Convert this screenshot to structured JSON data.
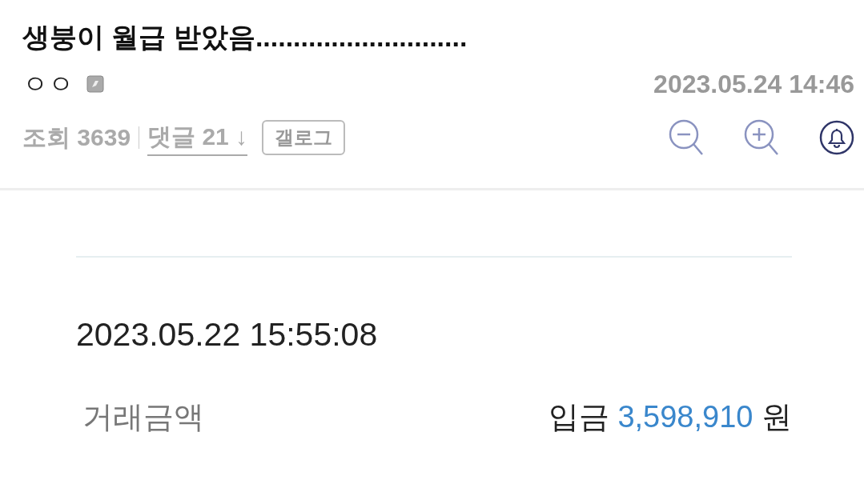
{
  "post": {
    "title": "생붕이 월급 받았음............................",
    "author": "ㅇㅇ",
    "date": "2023.05.24 14:46",
    "views_label": "조회",
    "views": "3639",
    "comments_label": "댓글",
    "comments": "21",
    "comments_arrow": "↓",
    "gallog_button": "갤로그"
  },
  "transaction": {
    "datetime": "2023.05.22 15:55:08",
    "amount_label": "거래금액",
    "type": "입금",
    "amount": "3,598,910",
    "unit": "원"
  }
}
